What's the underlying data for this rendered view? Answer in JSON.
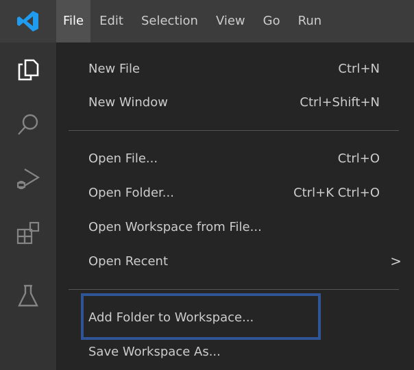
{
  "titlebar": {
    "logo_icon": "vscode-logo-icon",
    "menus": [
      {
        "label": "File",
        "active": true
      },
      {
        "label": "Edit"
      },
      {
        "label": "Selection"
      },
      {
        "label": "View"
      },
      {
        "label": "Go"
      },
      {
        "label": "Run"
      }
    ]
  },
  "activitybar": {
    "icons": [
      "files-icon",
      "search-icon",
      "run-debug-icon",
      "extensions-icon",
      "testing-icon"
    ]
  },
  "file_menu": {
    "items": [
      {
        "label": "New File",
        "shortcut": "Ctrl+N"
      },
      {
        "label": "New Window",
        "shortcut": "Ctrl+Shift+N"
      },
      {
        "label": "Open File...",
        "shortcut": "Ctrl+O"
      },
      {
        "label": "Open Folder...",
        "shortcut": "Ctrl+K Ctrl+O"
      },
      {
        "label": "Open Workspace from File...",
        "shortcut": ""
      },
      {
        "label": "Open Recent",
        "submenu_arrow": ">"
      },
      {
        "label": "Add Folder to Workspace...",
        "highlighted": true
      },
      {
        "label": "Save Workspace As..."
      }
    ]
  },
  "colors": {
    "titlebar_bg": "#3c3c3c",
    "activitybar_bg": "#333333",
    "menu_bg": "#252526",
    "highlight_border": "#2f5597",
    "logo_blue": "#1f9cf0"
  }
}
